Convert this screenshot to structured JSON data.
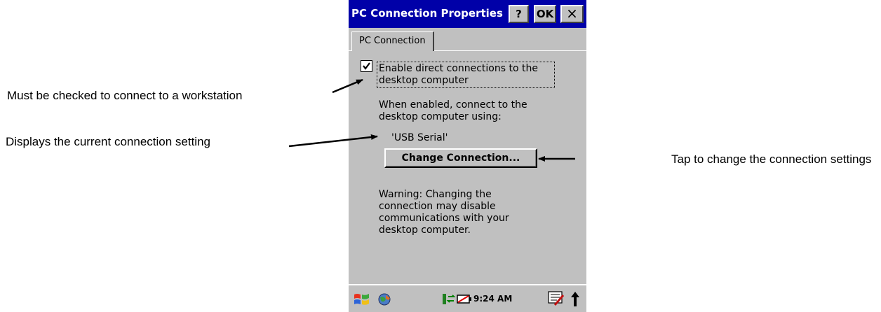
{
  "window": {
    "title": "PC Connection Properties",
    "help_label": "?",
    "ok_label": "OK",
    "close_label": "×"
  },
  "tab": {
    "label": "PC Connection"
  },
  "panel": {
    "checkbox_checked": true,
    "checkbox_line1": "Enable direct connections to the",
    "checkbox_line2": "desktop computer",
    "when_line1": "When enabled, connect to the",
    "when_line2": "desktop computer using:",
    "current_connection": "'USB Serial'",
    "change_button": "Change Connection...",
    "warning_line1": "Warning: Changing the",
    "warning_line2": "connection may disable",
    "warning_line3": "communications with your",
    "warning_line4": "desktop computer."
  },
  "taskbar": {
    "time": "9:24 AM",
    "icons": [
      "windows-start-icon",
      "connectivity-icon",
      "sync-icon",
      "battery-icon",
      "input-panel-icon",
      "up-arrow-icon"
    ]
  },
  "callouts": {
    "checkbox_note": "Must be checked to connect to a workstation",
    "setting_note": "Displays the current connection setting",
    "button_note": "Tap to change the connection settings"
  }
}
